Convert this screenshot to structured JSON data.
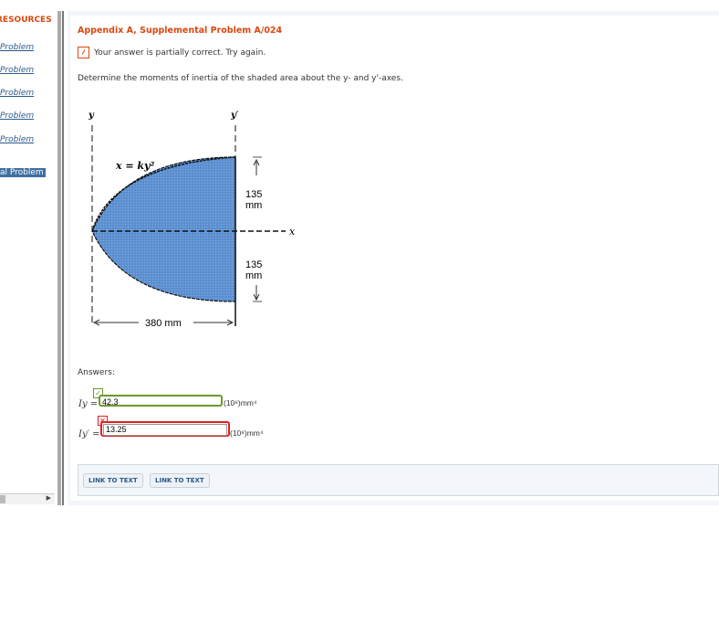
{
  "sidebar": {
    "header": "RESOURCES",
    "items": [
      "Problem",
      "Problem",
      "Problem",
      "Problem",
      "Problem"
    ],
    "selected": "al Problem"
  },
  "main": {
    "title": "Appendix A, Supplemental Problem A/024",
    "status": "Your answer is partially correct.  Try again.",
    "question": "Determine the moments of inertia of the shaded area about the y- and y'-axes.",
    "figure": {
      "y_label": "y",
      "yp_label": "y′",
      "x_label": "x",
      "equation": "x = ky²",
      "dim_top": "135",
      "dim_bottom": "135",
      "dim_unit": "mm",
      "dim_width": "380 mm",
      "fill_color": "#5b8fd0"
    },
    "answers_label": "Answers:",
    "answers": [
      {
        "label": "Iy =",
        "value": "42.3",
        "unit": "(10⁸)mm⁴",
        "status": "correct"
      },
      {
        "label": "Iy′ =",
        "value": "13.25",
        "unit": "(10⁸)mm⁴",
        "status": "incorrect"
      }
    ],
    "buttons": [
      "LINK TO TEXT",
      "LINK TO TEXT"
    ]
  },
  "colors": {
    "accent": "#d9480f",
    "correct": "#6a9a2a",
    "incorrect": "#e02020"
  }
}
